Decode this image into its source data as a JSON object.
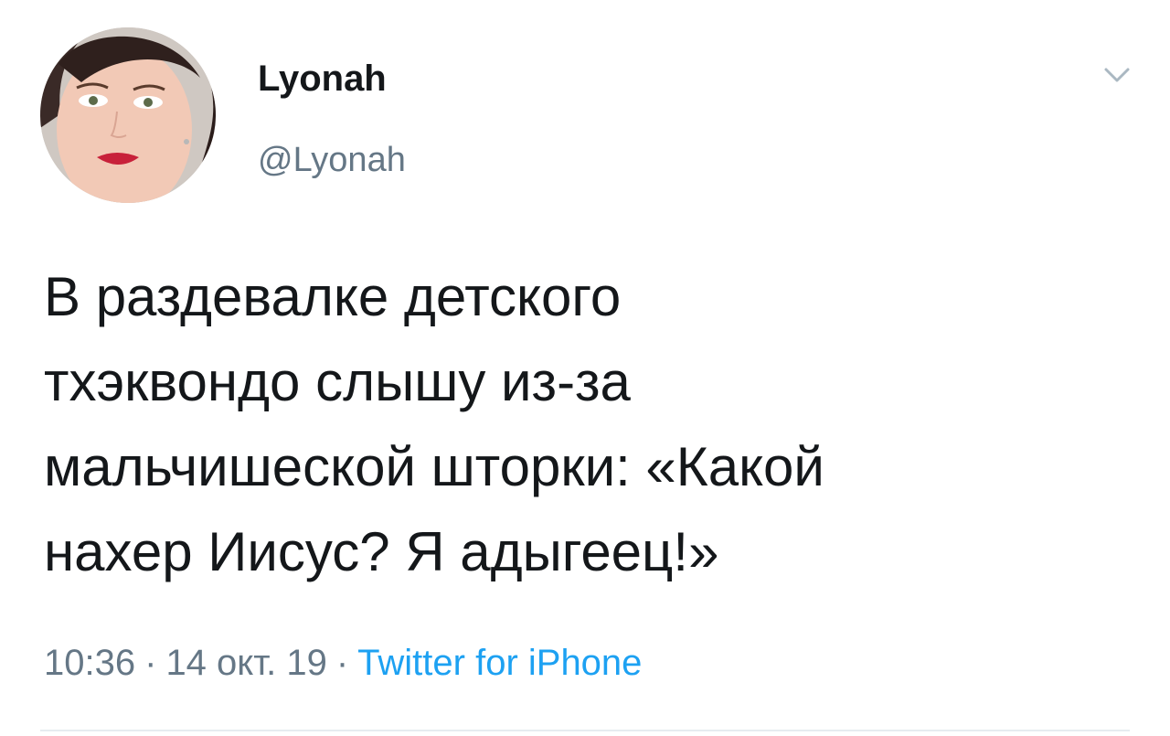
{
  "author": {
    "display_name": "Lyonah",
    "handle": "@Lyonah"
  },
  "tweet": {
    "text": "В раздевалке детского\nтхэквондо слышу из-за\nмальчишеской шторки: «Какой\nнахер Иисус? Я адыгеец!»"
  },
  "meta": {
    "time": "10:36",
    "separator": "·",
    "date": "14 окт. 19",
    "source": "Twitter for iPhone"
  },
  "icons": {
    "menu": "chevron-down-icon"
  },
  "colors": {
    "text": "#14171a",
    "secondary": "#657786",
    "link": "#1da1f2",
    "divider": "#e6ecf0"
  }
}
